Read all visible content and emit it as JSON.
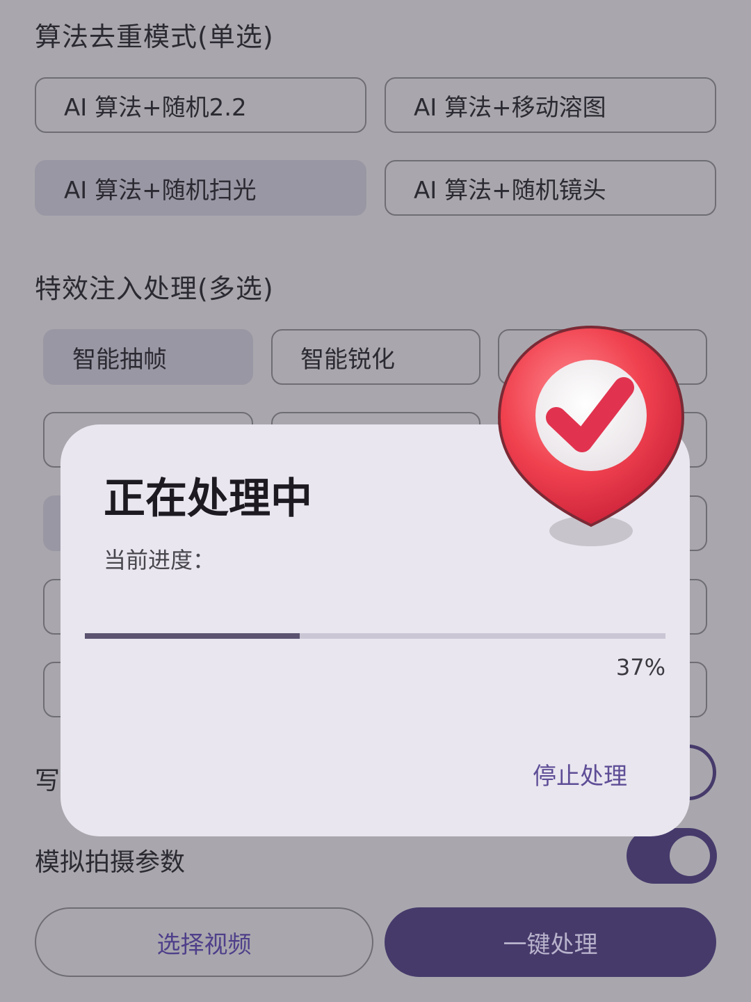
{
  "section_dedup": {
    "title": "算法去重模式(单选)",
    "options": [
      {
        "label": "AI 算法+随机2.2"
      },
      {
        "label": "AI 算法+移动溶图"
      },
      {
        "label": "AI 算法+随机扫光",
        "selected": true
      },
      {
        "label": "AI 算法+随机镜头"
      }
    ]
  },
  "section_effects": {
    "title": "特效注入处理(多选)",
    "options": [
      {
        "label": "智能抽帧",
        "selected": true
      },
      {
        "label": "智能锐化"
      }
    ]
  },
  "rows": {
    "write_label_partial": "写",
    "simulate_label": "模拟拍摄参数"
  },
  "buttons": {
    "select_video": "选择视频",
    "one_click": "一键处理"
  },
  "dialog": {
    "title": "正在处理中",
    "progress_label": "当前进度：",
    "progress_value": 0.37,
    "progress_text": "37%",
    "stop_label": "停止处理"
  },
  "icons": {
    "badge": "check-badge-icon"
  },
  "colors": {
    "background": "#a9a7ad",
    "selected_option": "#9a97a4",
    "primary": "#463a6b",
    "dialog": "#e9e6ef",
    "accent_text": "#5e4d96",
    "badge_red": "#e8384f"
  }
}
